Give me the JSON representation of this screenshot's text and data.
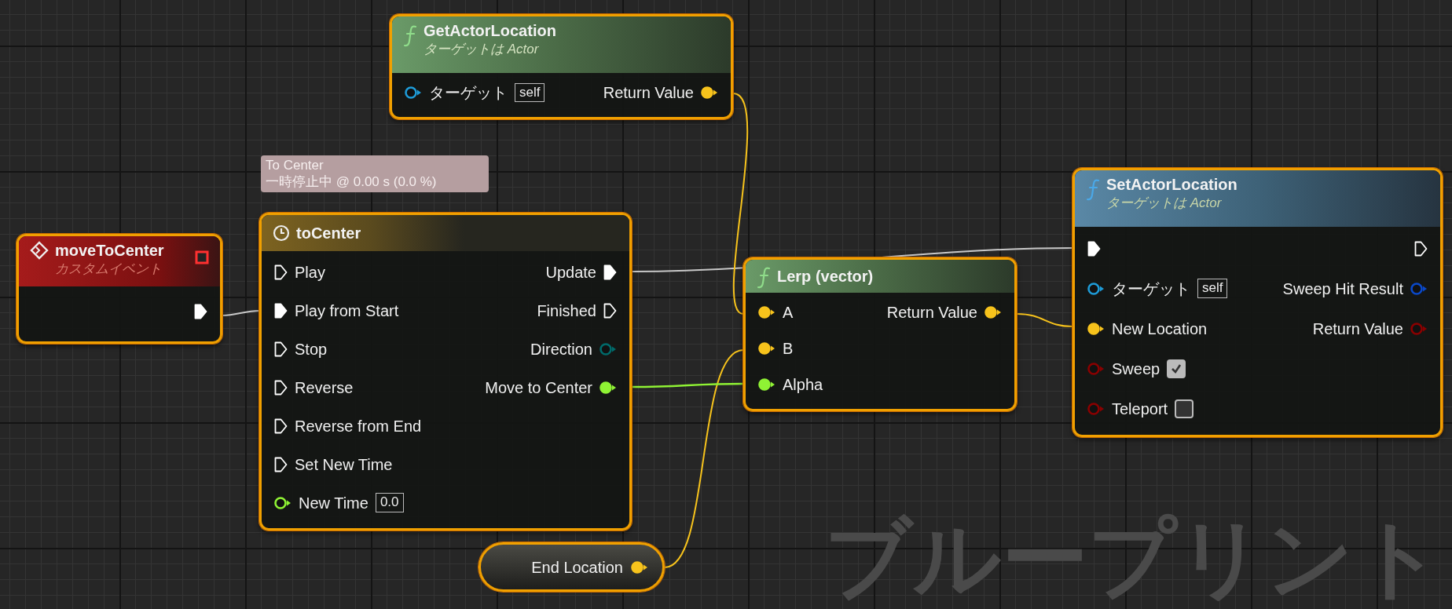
{
  "graph_label": "ブループリント",
  "tooltip": {
    "lines": [
      "To Center",
      "一時停止中 @ 0.00 s (0.0 %)"
    ]
  },
  "nodes": [
    {
      "kind": "event",
      "title": "moveToCenter",
      "subtitle": "カスタムイベント",
      "selected": true,
      "outputs": [
        {
          "kind": "exec",
          "connected": true
        }
      ]
    },
    {
      "kind": "timeline",
      "title": "toCenter",
      "selected": true,
      "inputs": [
        {
          "kind": "exec",
          "label": "Play",
          "connected": false
        },
        {
          "kind": "exec",
          "label": "Play from Start",
          "connected": true
        },
        {
          "kind": "exec",
          "label": "Stop",
          "connected": false
        },
        {
          "kind": "exec",
          "label": "Reverse",
          "connected": false
        },
        {
          "kind": "exec",
          "label": "Reverse from End",
          "connected": false
        },
        {
          "kind": "exec",
          "label": "Set New Time",
          "connected": false
        },
        {
          "kind": "float",
          "label": "New Time",
          "connected": false,
          "default": "0.0"
        }
      ],
      "outputs": [
        {
          "kind": "exec",
          "label": "Update",
          "connected": true
        },
        {
          "kind": "exec",
          "label": "Finished",
          "connected": false
        },
        {
          "kind": "enum",
          "label": "Direction",
          "connected": false
        },
        {
          "kind": "float",
          "label": "Move to Center",
          "connected": true
        }
      ]
    },
    {
      "kind": "pure_function",
      "title": "GetActorLocation",
      "subtitle": "ターゲットは Actor",
      "selected": true,
      "inputs": [
        {
          "kind": "object",
          "label": "ターゲット",
          "connected": false,
          "default": "self"
        }
      ],
      "outputs": [
        {
          "kind": "vector",
          "label": "Return Value",
          "connected": true
        }
      ]
    },
    {
      "kind": "pure_function",
      "title": "Lerp (vector)",
      "selected": true,
      "inputs": [
        {
          "kind": "vector",
          "label": "A",
          "connected": true
        },
        {
          "kind": "vector",
          "label": "B",
          "connected": true
        },
        {
          "kind": "float",
          "label": "Alpha",
          "connected": true
        }
      ],
      "outputs": [
        {
          "kind": "vector",
          "label": "Return Value",
          "connected": true
        }
      ]
    },
    {
      "kind": "function",
      "title": "SetActorLocation",
      "subtitle": "ターゲットは Actor",
      "selected": true,
      "inputs": [
        {
          "kind": "exec",
          "connected": true
        },
        {
          "kind": "object",
          "label": "ターゲット",
          "connected": false,
          "default": "self"
        },
        {
          "kind": "vector",
          "label": "New Location",
          "connected": true
        },
        {
          "kind": "bool",
          "label": "Sweep",
          "connected": false,
          "checked": true
        },
        {
          "kind": "bool",
          "label": "Teleport",
          "connected": false,
          "checked": false
        }
      ],
      "outputs": [
        {
          "kind": "exec",
          "connected": false
        },
        {
          "kind": "struct",
          "label": "Sweep Hit Result",
          "connected": false
        },
        {
          "kind": "bool",
          "label": "Return Value",
          "connected": false
        }
      ]
    },
    {
      "kind": "variable",
      "title": "End Location",
      "selected": true,
      "outputs": [
        {
          "kind": "vector",
          "connected": true
        }
      ]
    }
  ]
}
